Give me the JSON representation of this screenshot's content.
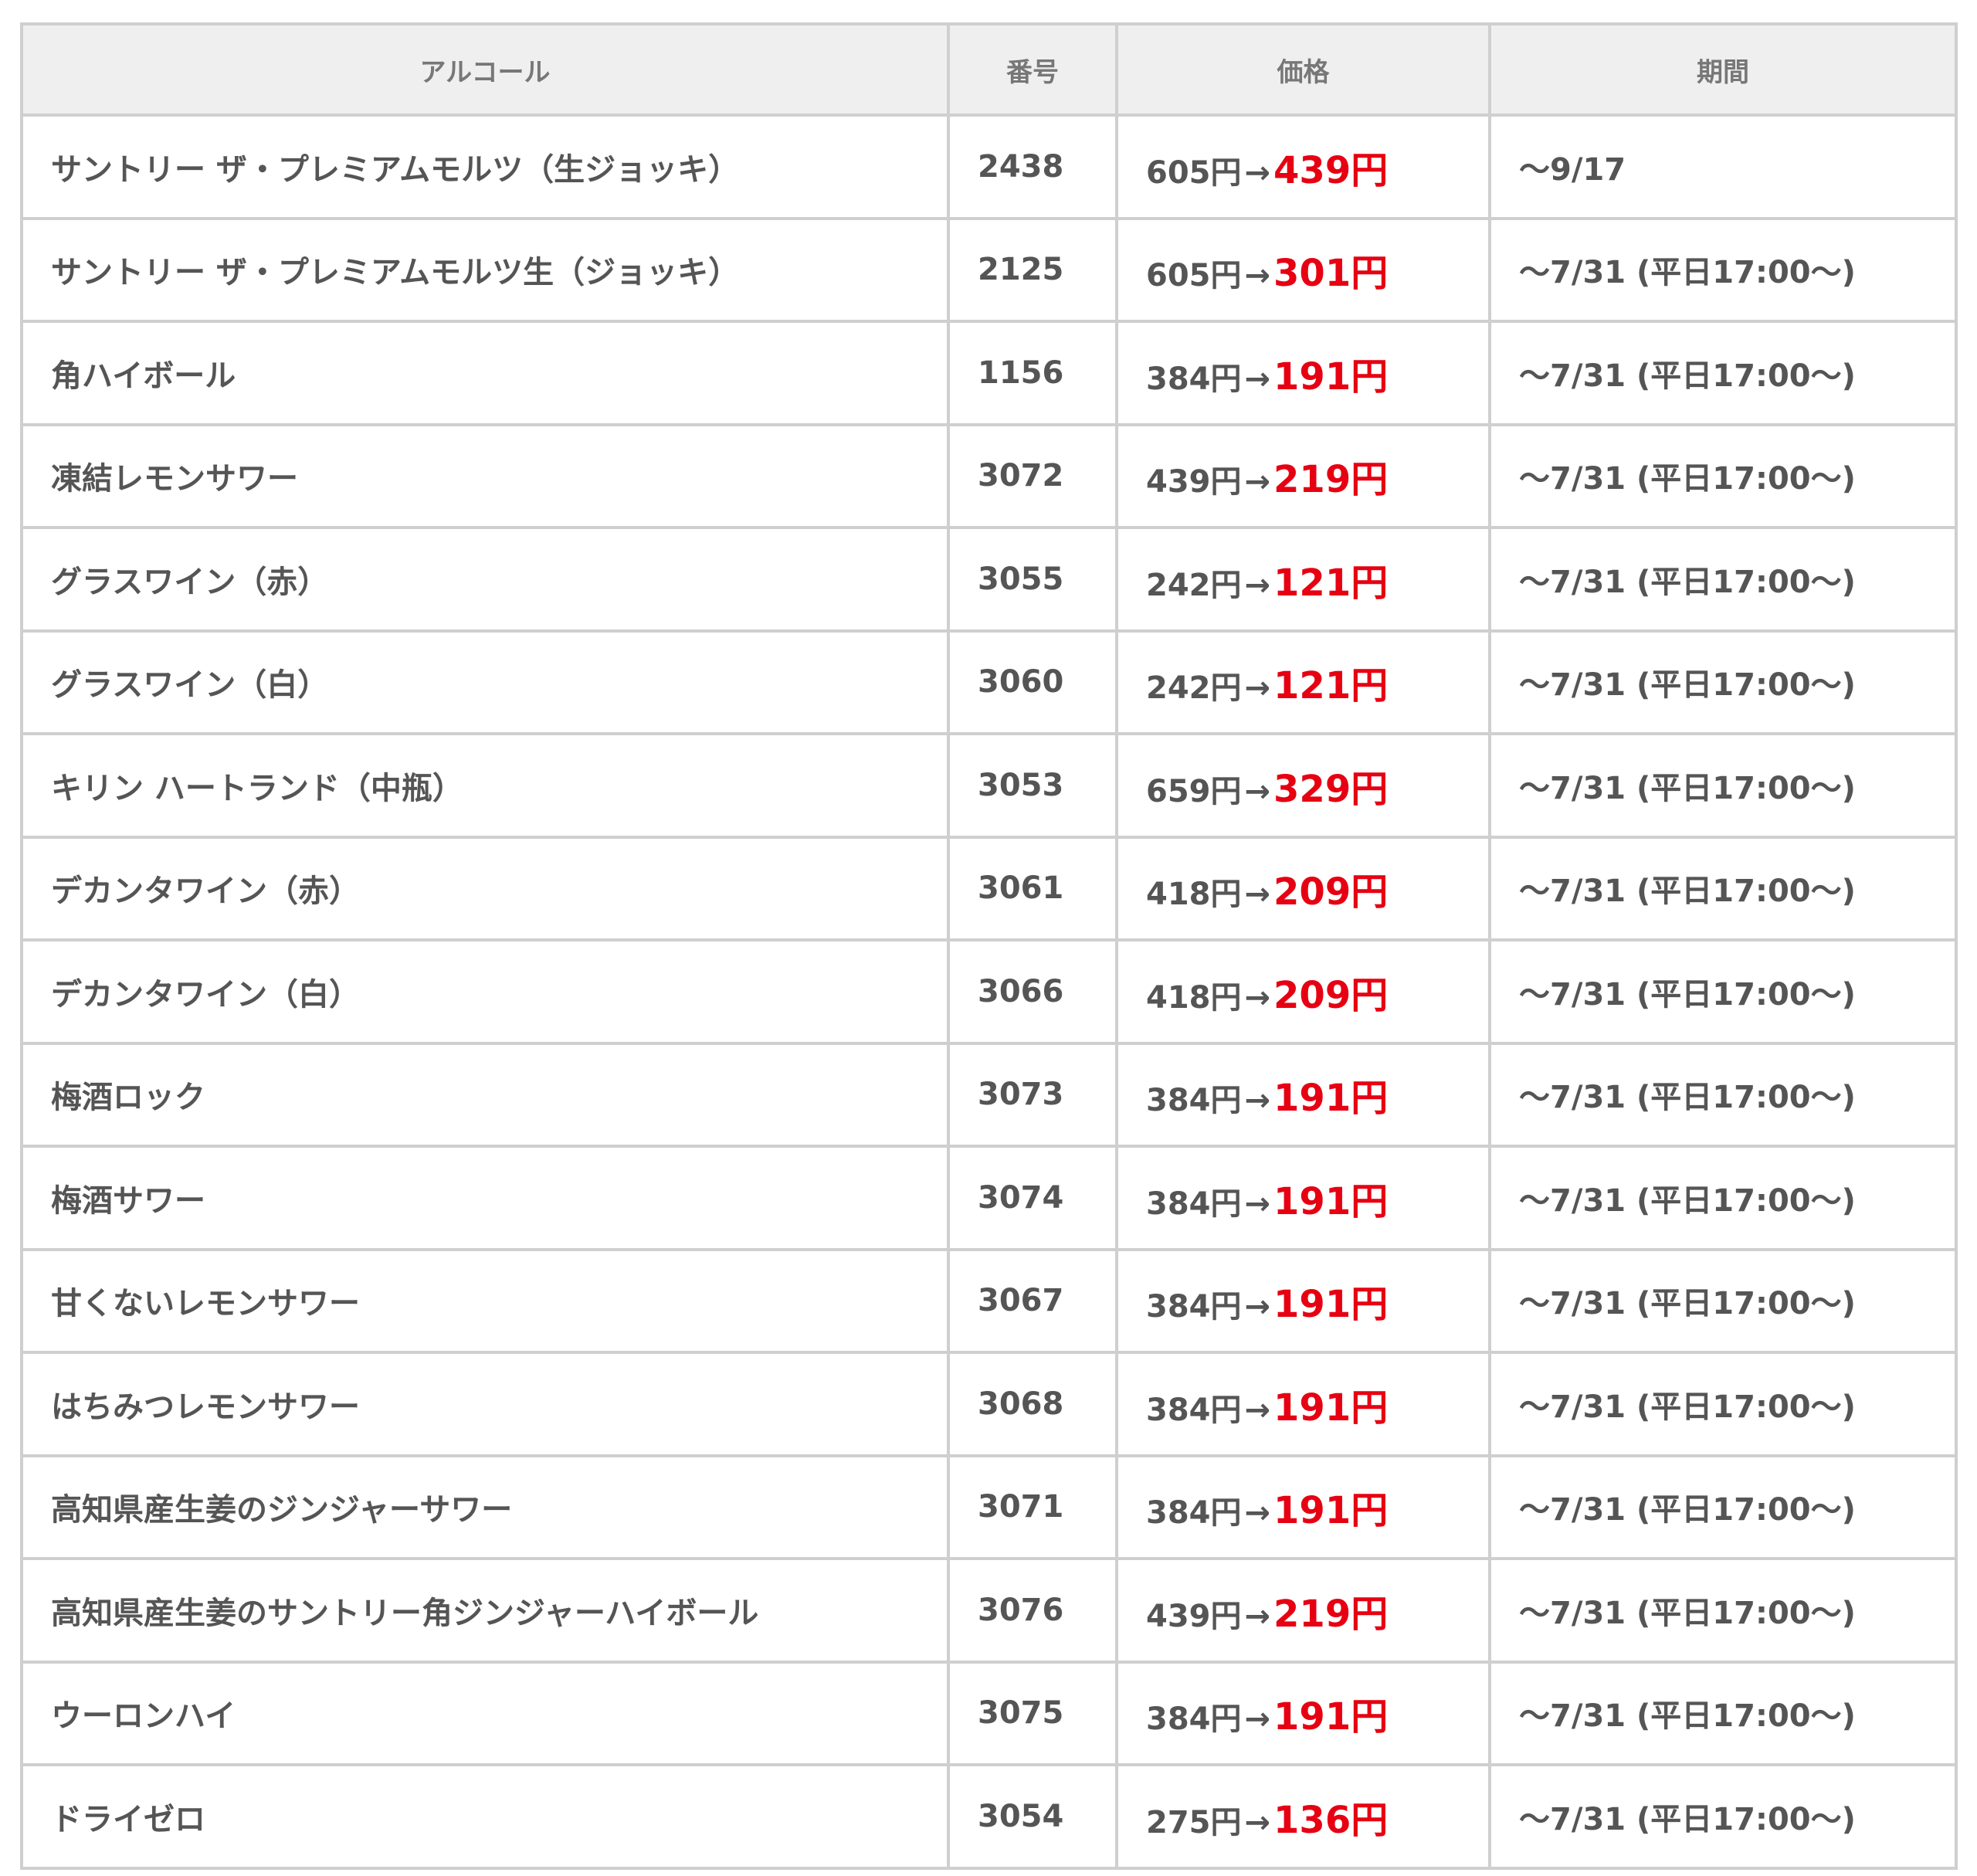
{
  "table": {
    "headers": {
      "name": "アルコール",
      "number": "番号",
      "price": "価格",
      "period": "期間"
    },
    "arrow": "→",
    "rows": [
      {
        "name": "サントリー ザ・プレミアムモルツ（生ジョッキ）",
        "number": "2438",
        "old_price": "605円",
        "new_price": "439円",
        "period": "～9/17"
      },
      {
        "name": "サントリー ザ・プレミアムモルツ生（ジョッキ）",
        "number": "2125",
        "old_price": "605円",
        "new_price": "301円",
        "period": "～7/31 (平日17:00～)"
      },
      {
        "name": "角ハイボール",
        "number": "1156",
        "old_price": "384円",
        "new_price": "191円",
        "period": "～7/31 (平日17:00～)"
      },
      {
        "name": "凍結レモンサワー",
        "number": "3072",
        "old_price": "439円",
        "new_price": "219円",
        "period": "～7/31 (平日17:00～)"
      },
      {
        "name": "グラスワイン（赤）",
        "number": "3055",
        "old_price": "242円",
        "new_price": "121円",
        "period": "～7/31 (平日17:00～)"
      },
      {
        "name": "グラスワイン（白）",
        "number": "3060",
        "old_price": "242円",
        "new_price": "121円",
        "period": "～7/31 (平日17:00～)"
      },
      {
        "name": "キリン ハートランド（中瓶）",
        "number": "3053",
        "old_price": "659円",
        "new_price": "329円",
        "period": "～7/31 (平日17:00～)"
      },
      {
        "name": "デカンタワイン（赤）",
        "number": "3061",
        "old_price": "418円",
        "new_price": "209円",
        "period": "～7/31 (平日17:00～)"
      },
      {
        "name": "デカンタワイン（白）",
        "number": "3066",
        "old_price": "418円",
        "new_price": "209円",
        "period": "～7/31 (平日17:00～)"
      },
      {
        "name": "梅酒ロック",
        "number": "3073",
        "old_price": "384円",
        "new_price": "191円",
        "period": "～7/31 (平日17:00～)"
      },
      {
        "name": "梅酒サワー",
        "number": "3074",
        "old_price": "384円",
        "new_price": "191円",
        "period": "～7/31 (平日17:00～)"
      },
      {
        "name": "甘くないレモンサワー",
        "number": "3067",
        "old_price": "384円",
        "new_price": "191円",
        "period": "～7/31 (平日17:00～)"
      },
      {
        "name": "はちみつレモンサワー",
        "number": "3068",
        "old_price": "384円",
        "new_price": "191円",
        "period": "～7/31 (平日17:00～)"
      },
      {
        "name": "高知県産生姜のジンジャーサワー",
        "number": "3071",
        "old_price": "384円",
        "new_price": "191円",
        "period": "～7/31 (平日17:00～)"
      },
      {
        "name": "高知県産生姜のサントリー角ジンジャーハイボール",
        "number": "3076",
        "old_price": "439円",
        "new_price": "219円",
        "period": "～7/31 (平日17:00～)"
      },
      {
        "name": "ウーロンハイ",
        "number": "3075",
        "old_price": "384円",
        "new_price": "191円",
        "period": "～7/31 (平日17:00～)"
      },
      {
        "name": "ドライゼロ",
        "number": "3054",
        "old_price": "275円",
        "new_price": "136円",
        "period": "～7/31 (平日17:00～)"
      }
    ]
  }
}
